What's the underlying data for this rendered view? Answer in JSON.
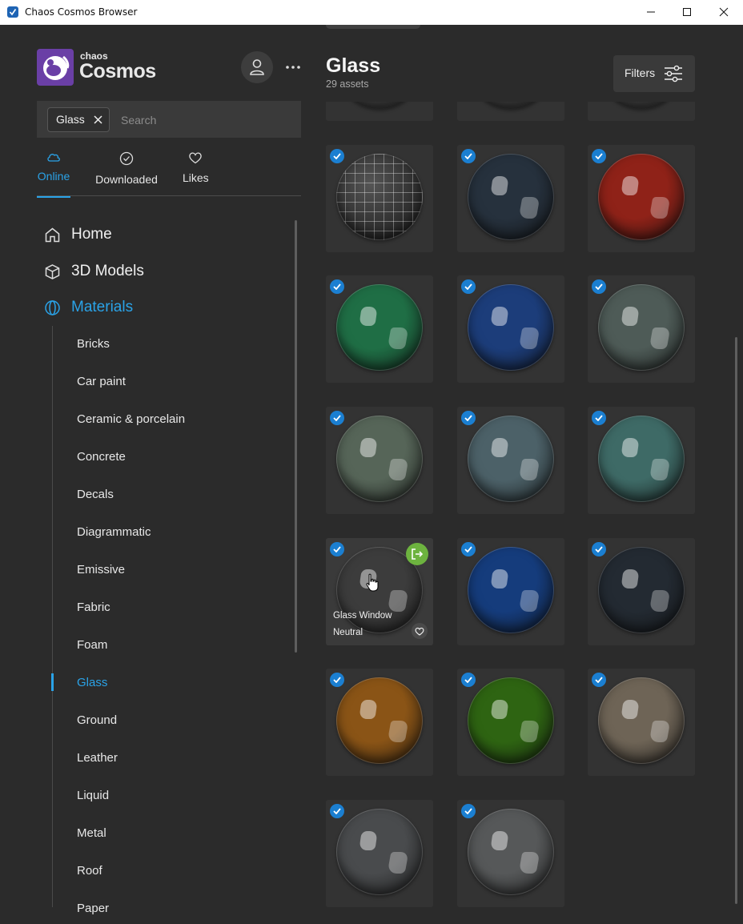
{
  "window": {
    "title": "Chaos Cosmos Browser"
  },
  "brand": {
    "small": "chaos",
    "big": "Cosmos",
    "accent": "#2aa3e8",
    "logo_bg": "#6a3fa6"
  },
  "search": {
    "chip": "Glass",
    "placeholder": "Search"
  },
  "tabs": [
    {
      "label": "Online",
      "icon": "cloud-icon",
      "active": true
    },
    {
      "label": "Downloaded",
      "icon": "check-circle-icon",
      "active": false
    },
    {
      "label": "Likes",
      "icon": "heart-icon",
      "active": false
    }
  ],
  "nav": [
    {
      "label": "Home",
      "icon": "home-icon"
    },
    {
      "label": "3D Models",
      "icon": "cube-icon"
    },
    {
      "label": "Materials",
      "icon": "materials-icon",
      "active": true
    }
  ],
  "categories": [
    "Bricks",
    "Car paint",
    "Ceramic & porcelain",
    "Concrete",
    "Decals",
    "Diagrammatic",
    "Emissive",
    "Fabric",
    "Foam",
    "Glass",
    "Ground",
    "Leather",
    "Liquid",
    "Metal",
    "Roof",
    "Paper"
  ],
  "active_category": "Glass",
  "header": {
    "title": "Glass",
    "count": "29 assets",
    "filters_label": "Filters"
  },
  "assets": [
    {
      "color": "#3e3e3e",
      "style": "grid"
    },
    {
      "color": "#26313d"
    },
    {
      "color": "#8f2218"
    },
    {
      "color": "#1f6e45"
    },
    {
      "color": "#1c3d7a"
    },
    {
      "color": "#4e5b57"
    },
    {
      "color": "#566558"
    },
    {
      "color": "#4c6168"
    },
    {
      "color": "#3e6a66"
    },
    {
      "color": "#3c3c3c",
      "title": "Glass Window Neutral",
      "hover": true
    },
    {
      "color": "#153c7c"
    },
    {
      "color": "#232a32"
    },
    {
      "color": "#8a5416"
    },
    {
      "color": "#2e6412"
    },
    {
      "color": "#6e6456"
    },
    {
      "color": "#494b4d"
    },
    {
      "color": "#565859"
    }
  ]
}
